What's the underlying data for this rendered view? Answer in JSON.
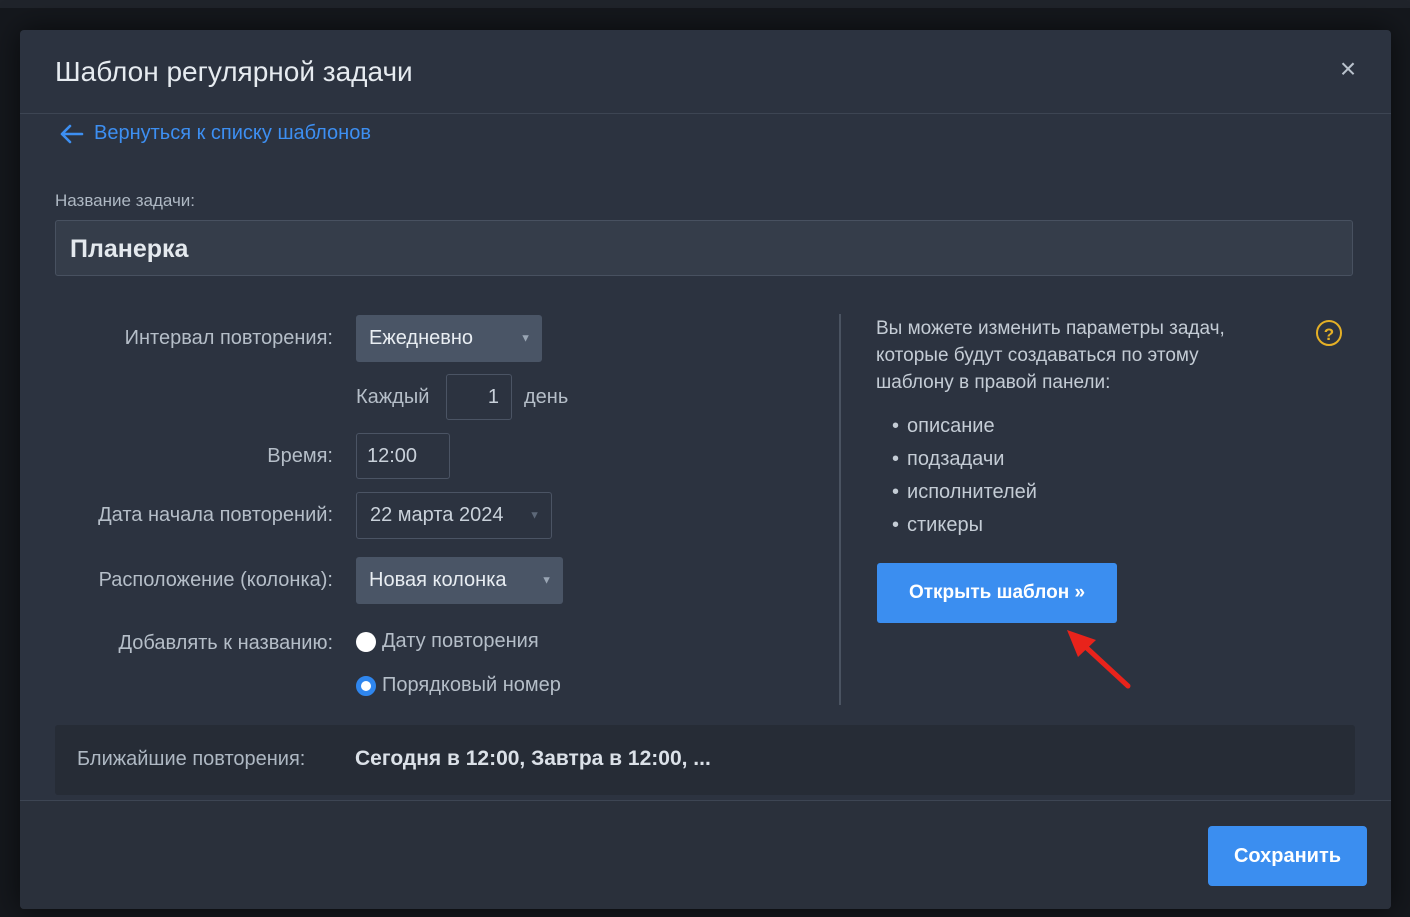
{
  "modal": {
    "title": "Шаблон регулярной задачи",
    "close_glyph": "×",
    "back_link": "Вернуться к списку шаблонов",
    "task_name_label": "Название задачи:",
    "task_name_value": "Планерка"
  },
  "form": {
    "interval_label": "Интервал повторения:",
    "interval_value": "Ежедневно",
    "every_label": "Каждый",
    "every_value": "1",
    "every_unit": "день",
    "time_label": "Время:",
    "time_value": "12:00",
    "start_date_label": "Дата начала повторений:",
    "start_date_value": "22 марта 2024",
    "location_label": "Расположение (колонка):",
    "location_value": "Новая колонка",
    "append_label": "Добавлять к названию:",
    "append_options": [
      {
        "label": "Дату повторения",
        "selected": false
      },
      {
        "label": "Порядковый номер",
        "selected": true
      }
    ]
  },
  "info": {
    "text": "Вы можете изменить параметры задач, которые будут создаваться по этому шаблону в правой панели:",
    "help_glyph": "?",
    "items": [
      "описание",
      "подзадачи",
      "исполнителей",
      "стикеры"
    ],
    "open_button": "Открыть шаблон »"
  },
  "next": {
    "label": "Ближайшие повторения:",
    "value": "Сегодня в 12:00, Завтра в 12:00, ..."
  },
  "footer": {
    "save_button": "Сохранить"
  },
  "colors": {
    "accent": "#3b8ef0",
    "modal_bg": "#2c3340",
    "help": "#e5b026",
    "annotation_arrow": "#e8231b"
  }
}
